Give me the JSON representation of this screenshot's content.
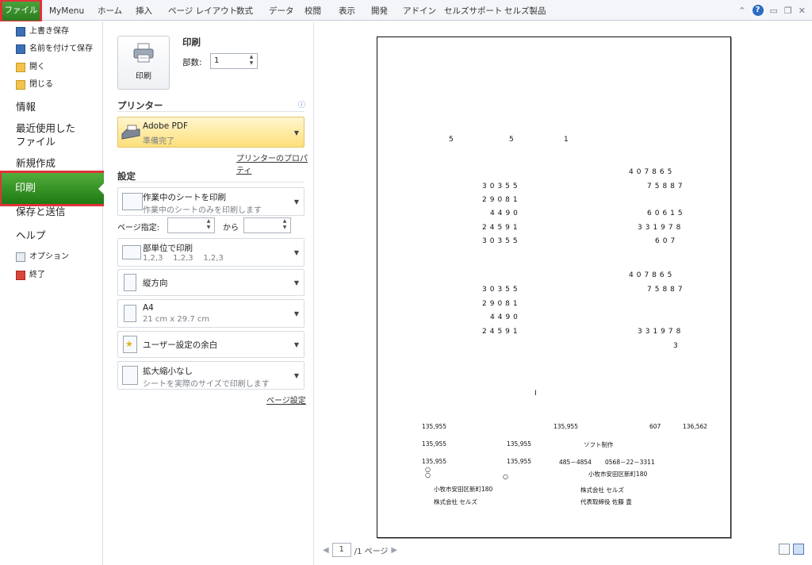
{
  "ribbon": {
    "tabs": [
      "ファイル",
      "MyMenu",
      "ホーム",
      "挿入",
      "ページ レイアウト",
      "数式",
      "データ",
      "校閲",
      "表示",
      "開発",
      "アドイン",
      "セルズサポート",
      "セルズ製品"
    ],
    "help_icon": "help-icon"
  },
  "nav": {
    "save": "上書き保存",
    "save_as": "名前を付けて保存",
    "open": "開く",
    "close": "閉じる",
    "info": "情報",
    "recent_1": "最近使用した",
    "recent_2": "ファイル",
    "new": "新規作成",
    "print": "印刷",
    "save_send": "保存と送信",
    "help": "ヘルプ",
    "options": "オプション",
    "exit": "終了"
  },
  "print": {
    "button_label": "印刷",
    "title": "印刷",
    "copies_label": "部数:",
    "copies_value": "1"
  },
  "printer": {
    "section": "プリンター",
    "name": "Adobe PDF",
    "status": "準備完了",
    "properties_link": "プリンターのプロパティ"
  },
  "settings": {
    "section": "設定",
    "scope_title": "作業中のシートを印刷",
    "scope_sub": "作業中のシートのみを印刷します",
    "pages_label": "ページ指定:",
    "pages_to": "から",
    "collate_title": "部単位で印刷",
    "collate_sub": "1,2,3    1,2,3    1,2,3",
    "orientation": "縦方向",
    "paper_title": "A4",
    "paper_sub": "21 cm x 29.7 cm",
    "margins": "ユーザー設定の余白",
    "scaling_title": "拡大縮小なし",
    "scaling_sub": "シートを実際のサイズで印刷します",
    "page_setup_link": "ページ設定"
  },
  "preview": {
    "row_a": [
      "5",
      "5",
      "1"
    ],
    "left_block_1": [
      "30355",
      "29081",
      "4490",
      "24591",
      "30355"
    ],
    "right_block_1": [
      "407865",
      "75887",
      "60615",
      "331978",
      "607"
    ],
    "left_block_2": [
      "30355",
      "29081",
      "4490",
      "24591"
    ],
    "right_block_2": [
      "407865",
      "75887",
      "331978",
      "3"
    ],
    "mid_mark": "I",
    "line1": [
      "135,955",
      "135,955",
      "607",
      "136,562"
    ],
    "line2": [
      "135,955",
      "135,955",
      "ソフト制作"
    ],
    "line3": [
      "135,955",
      "135,955",
      "485－4854",
      "0568－22－3311"
    ],
    "addr_left": "小牧市安田区新町180",
    "company_left": "株式会社 セルズ",
    "addr_right": "小牧市安田区新町180",
    "company_right": "株式会社 セルズ",
    "rep": "代表取締役 佐藤 豊",
    "circle": "○"
  },
  "pager": {
    "page": "1",
    "of": "/1 ページ"
  }
}
